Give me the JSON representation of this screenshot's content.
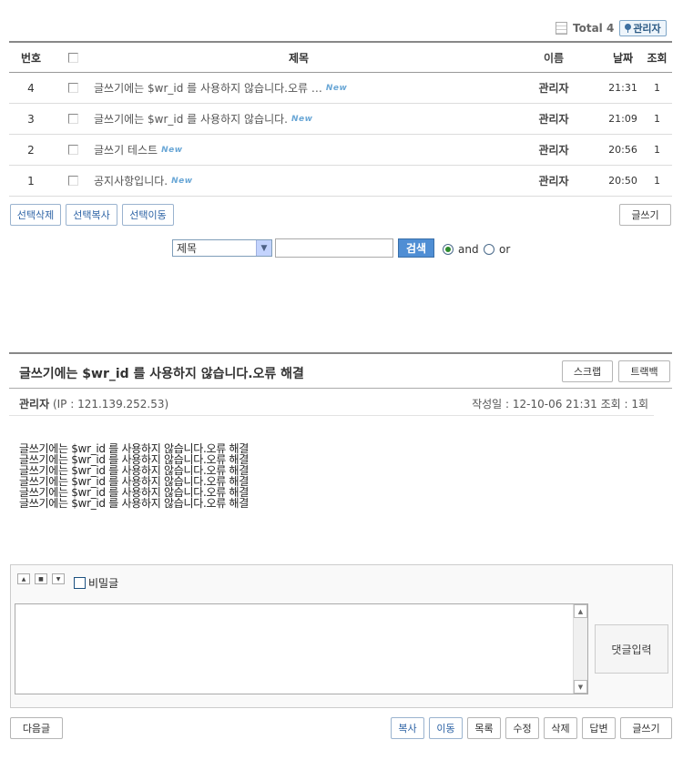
{
  "header": {
    "total_label": "Total 4",
    "admin_label": "관리자"
  },
  "list": {
    "columns": {
      "num": "번호",
      "subject": "제목",
      "name": "이름",
      "date": "날짜",
      "hits": "조회"
    },
    "rows": [
      {
        "num": "4",
        "subject": "글쓰기에는 $wr_id 를 사용하지 않습니다.오류 …",
        "name": "관리자",
        "date": "21:31",
        "hits": "1"
      },
      {
        "num": "3",
        "subject": "글쓰기에는 $wr_id 를 사용하지 않습니다.",
        "name": "관리자",
        "date": "21:09",
        "hits": "1"
      },
      {
        "num": "2",
        "subject": "글쓰기 테스트",
        "name": "관리자",
        "date": "20:56",
        "hits": "1"
      },
      {
        "num": "1",
        "subject": "공지사항입니다.",
        "name": "관리자",
        "date": "20:50",
        "hits": "1"
      }
    ],
    "new_badge": "New"
  },
  "list_actions": {
    "delete": "선택삭제",
    "copy": "선택복사",
    "move": "선택이동",
    "write": "글쓰기"
  },
  "search": {
    "field": "제목",
    "button": "검색",
    "and": "and",
    "or": "or"
  },
  "view": {
    "title": "글쓰기에는 $wr_id 를 사용하지 않습니다.오류 해결",
    "scrap": "스크랩",
    "trackback": "트랙백",
    "author": "관리자",
    "ip": "(IP : 121.139.252.53)",
    "meta": "작성일 : 12-10-06 21:31  조회 : 1회",
    "body": [
      "글쓰기에는 $wr_id 를 사용하지 않습니다.오류 해결",
      "글쓰기에는 $wr_id 를 사용하지 않습니다.오류 해결",
      "글쓰기에는 $wr_id 를 사용하지 않습니다.오류 해결",
      "글쓰기에는 $wr_id 를 사용하지 않습니다.오류 해결",
      "글쓰기에는 $wr_id 를 사용하지 않습니다.오류 해결",
      "글쓰기에는 $wr_id 를 사용하지 않습니다.오류 해결"
    ]
  },
  "comment": {
    "secret": "비밀글",
    "submit": "댓글입력"
  },
  "bottom": {
    "next": "다음글",
    "copy": "복사",
    "move": "이동",
    "list": "목록",
    "edit": "수정",
    "delete": "삭제",
    "reply": "답변",
    "write": "글쓰기"
  }
}
